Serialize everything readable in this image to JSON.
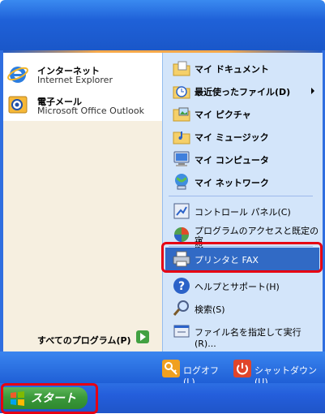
{
  "left_pinned": [
    {
      "title": "インターネット",
      "subtitle": "Internet Explorer",
      "icon": "internet-explorer-icon"
    },
    {
      "title": "電子メール",
      "subtitle": "Microsoft Office Outlook",
      "icon": "outlook-icon"
    }
  ],
  "all_programs": "すべてのプログラム(P)",
  "right_items": [
    {
      "label": "マイ ドキュメント",
      "icon": "my-documents-icon"
    },
    {
      "label": "最近使ったファイル(D)",
      "icon": "recent-files-icon"
    },
    {
      "label": "マイ ピクチャ",
      "icon": "my-pictures-icon"
    },
    {
      "label": "マイ ミュージック",
      "icon": "my-music-icon"
    },
    {
      "label": "マイ コンピュータ",
      "icon": "my-computer-icon"
    },
    {
      "label": "マイ ネットワーク",
      "icon": "my-network-icon"
    },
    {
      "label": "コントロール パネル(C)",
      "icon": "control-panel-icon"
    },
    {
      "label_line1": "プログラムのアクセスと既定の設",
      "label_line2": "定",
      "icon": "program-access-icon"
    },
    {
      "label": "プリンタと FAX",
      "icon": "printer-fax-icon"
    },
    {
      "label": "ヘルプとサポート(H)",
      "icon": "help-icon"
    },
    {
      "label": "検索(S)",
      "icon": "search-icon"
    },
    {
      "label": "ファイル名を指定して実行(R)...",
      "icon": "run-icon"
    }
  ],
  "bottom": {
    "logoff": "ログオフ(L)",
    "shutdown": "シャットダウン(U)"
  },
  "start_label": "スタート",
  "colors": {
    "highlight": "#316ac5",
    "annotation": "#e60012",
    "right_pane": "#d3e5fa"
  }
}
